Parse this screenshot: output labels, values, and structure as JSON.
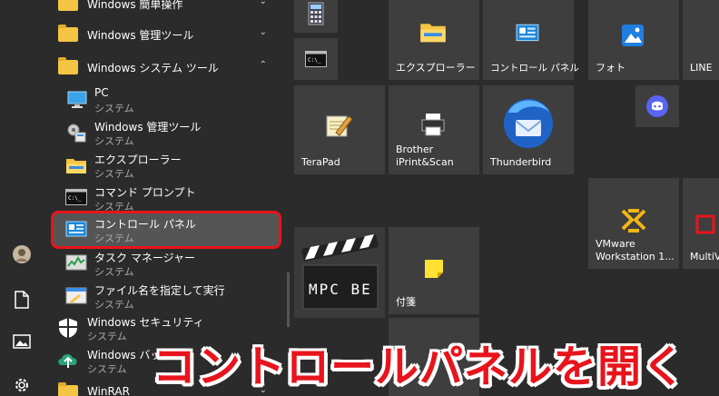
{
  "app_list": [
    {
      "id": "easy",
      "title": "Windows 簡単操作",
      "kind": "folder",
      "chevron": "⌄"
    },
    {
      "id": "admin-folder",
      "title": "Windows 管理ツール",
      "kind": "folder",
      "chevron": "⌄"
    },
    {
      "id": "system-folder",
      "title": "Windows システム ツール",
      "kind": "folder",
      "chevron": "⌃"
    },
    {
      "id": "pc",
      "title": "PC",
      "subtitle": "システム"
    },
    {
      "id": "admin-tools",
      "title": "Windows 管理ツール",
      "subtitle": "システム"
    },
    {
      "id": "explorer",
      "title": "エクスプローラー",
      "subtitle": "システム"
    },
    {
      "id": "cmd",
      "title": "コマンド プロンプト",
      "subtitle": "システム"
    },
    {
      "id": "control-panel",
      "title": "コントロール パネル",
      "subtitle": "システム"
    },
    {
      "id": "task-manager",
      "title": "タスク マネージャー",
      "subtitle": "システム"
    },
    {
      "id": "run",
      "title": "ファイル名を指定して実行",
      "subtitle": "システム"
    },
    {
      "id": "security",
      "title": "Windows セキュリティ",
      "subtitle": "システム"
    },
    {
      "id": "backup",
      "title": "Windows バッ",
      "subtitle": "システム"
    },
    {
      "id": "winrar",
      "title": "WinRAR",
      "kind": "folder",
      "chevron": "⌄"
    }
  ],
  "tiles": {
    "explorer": "エクスプローラー",
    "control_panel": "コントロール パネル",
    "photos": "フォト",
    "line": "LINE",
    "terapad": "TeraPad",
    "brother": "Brother\niPrint&Scan",
    "thunderbird": "Thunderbird",
    "vmware": "VMware\nWorkstation 1...",
    "multiview": "MultiV",
    "mpc": "MPC BE",
    "sticky": "付箋"
  },
  "caption": "コントロールパネルを開く",
  "colors": {
    "highlight_border": "#e8141c",
    "caption": "#e8141c"
  }
}
